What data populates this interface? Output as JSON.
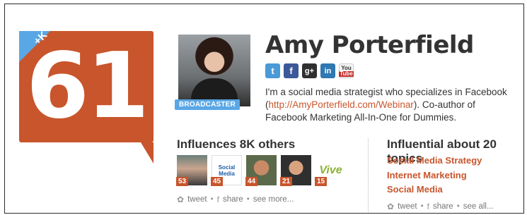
{
  "score": {
    "value": "61",
    "delta": "+K"
  },
  "profile": {
    "name": "Amy Porterfield",
    "badge": "BROADCASTER",
    "bio_prefix": "I'm a social media strategist who specializes in Facebook (",
    "bio_link": "http://AmyPorterfield.com/Webinar",
    "bio_suffix": "). Co-author of Facebook Marketing All-In-One for Dummies."
  },
  "socials": [
    {
      "icon": "twitter-icon",
      "glyph": "t"
    },
    {
      "icon": "facebook-icon",
      "glyph": "f"
    },
    {
      "icon": "googleplus-icon",
      "glyph": "g+"
    },
    {
      "icon": "linkedin-icon",
      "glyph": "in"
    },
    {
      "icon": "youtube-icon",
      "glyph_top": "You",
      "glyph_bottom": "Tube"
    }
  ],
  "influences": {
    "title": "Influences 8K others",
    "people": [
      {
        "score": "53"
      },
      {
        "score": "45",
        "logo_line1": "Social",
        "logo_line2": "Media"
      },
      {
        "score": "44"
      },
      {
        "score": "21"
      },
      {
        "score": "15",
        "logo": "Vive"
      }
    ],
    "actions": {
      "tweet": "tweet",
      "share": "share",
      "more": "see more..."
    }
  },
  "topics": {
    "title": "Influential about 20 topics",
    "items": [
      "Social Media Strategy",
      "Internet Marketing",
      "Social Media"
    ],
    "actions": {
      "tweet": "tweet",
      "share": "share",
      "more": "see all..."
    }
  },
  "colors": {
    "accent": "#c8552c",
    "blue": "#5aa7e6"
  }
}
